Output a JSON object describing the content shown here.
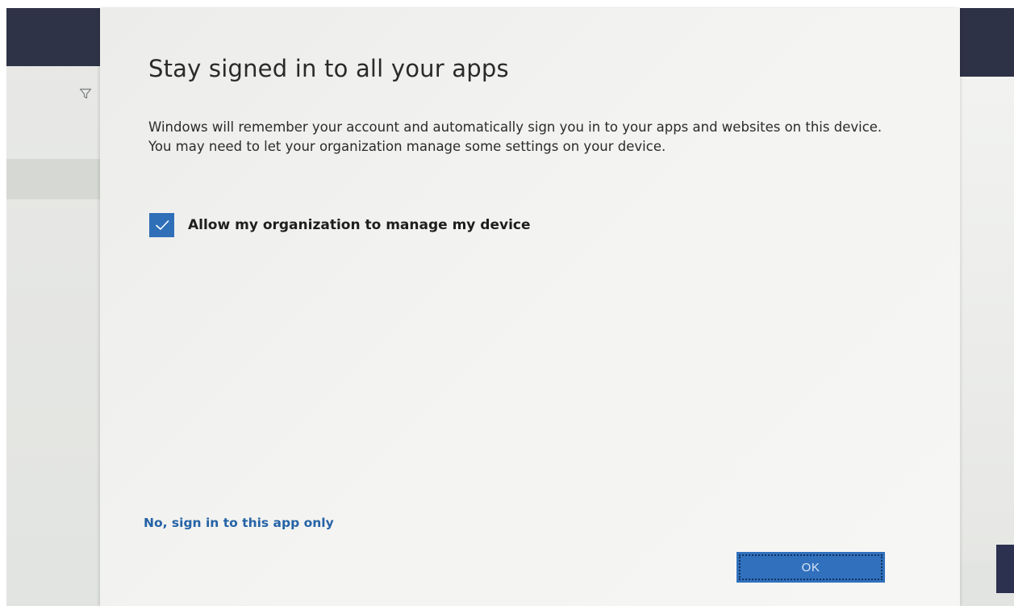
{
  "dialog": {
    "title": "Stay signed in to all your apps",
    "description": "Windows will remember your account and automatically sign you in to your apps and websites on this device. You may need to let your organization manage some settings on your device.",
    "checkbox": {
      "label": "Allow my organization to manage my device",
      "checked": true
    },
    "secondary_link": "No, sign in to this app only",
    "ok_button": "OK"
  },
  "background": {
    "icon": "filter-icon"
  },
  "colors": {
    "accent": "#2f6fb8",
    "link": "#2563a6",
    "button": "#3170bd",
    "dialog_bg": "#f3f3f1"
  }
}
